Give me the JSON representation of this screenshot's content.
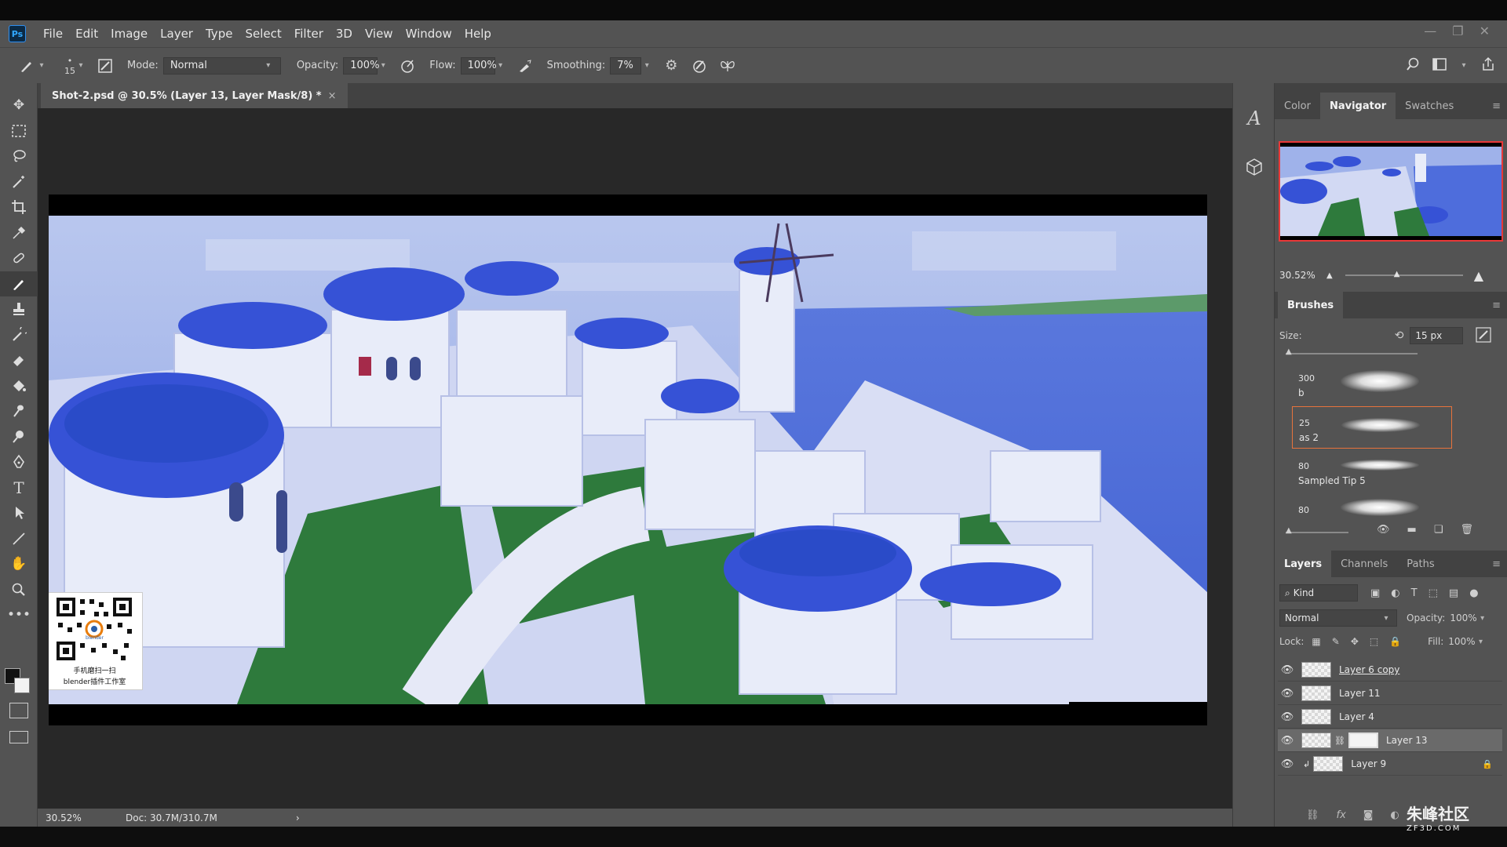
{
  "app": {
    "logo": "Ps",
    "menu": [
      "File",
      "Edit",
      "Image",
      "Layer",
      "Type",
      "Select",
      "Filter",
      "3D",
      "View",
      "Window",
      "Help"
    ],
    "window_controls": [
      "minimize-icon",
      "restore-icon",
      "close-icon"
    ]
  },
  "options": {
    "brush_size": "15",
    "mode_label": "Mode:",
    "mode_value": "Normal",
    "opacity_label": "Opacity:",
    "opacity_value": "100%",
    "flow_label": "Flow:",
    "flow_value": "100%",
    "smoothing_label": "Smoothing:",
    "smoothing_value": "7%"
  },
  "document": {
    "tab_title": "Shot-2.psd @ 30.5% (Layer 13, Layer Mask/8) *",
    "tab_close": "×",
    "watermark_line1": "手机磨扫一扫",
    "watermark_line2": "blender插件工作室",
    "watermark_badge": "blender"
  },
  "status": {
    "zoom": "30.52%",
    "doc_size": "Doc: 30.7M/310.7M",
    "arrow": "›"
  },
  "navigator": {
    "tabs": [
      "Color",
      "Navigator",
      "Swatches"
    ],
    "active_tab": "Navigator",
    "zoom": "30.52%"
  },
  "brushes": {
    "title": "Brushes",
    "size_label": "Size:",
    "size_value": "15 px",
    "items": [
      {
        "size": "300",
        "name": "b"
      },
      {
        "size": "25",
        "name": "as 2"
      },
      {
        "size": "80",
        "name": "Sampled Tip 5"
      },
      {
        "size": "80",
        "name": ""
      }
    ],
    "selected_index": 1
  },
  "layers": {
    "tabs": [
      "Layers",
      "Channels",
      "Paths"
    ],
    "active_tab": "Layers",
    "filter_label": "Kind",
    "blend_mode": "Normal",
    "opacity_label": "Opacity:",
    "opacity_value": "100%",
    "lock_label": "Lock:",
    "fill_label": "Fill:",
    "fill_value": "100%",
    "list": [
      {
        "name": "Layer 6 copy",
        "mask": false,
        "selected": false
      },
      {
        "name": "Layer 11",
        "mask": false,
        "selected": false
      },
      {
        "name": "Layer 4",
        "mask": false,
        "selected": false
      },
      {
        "name": "Layer 13",
        "mask": true,
        "selected": true
      },
      {
        "name": "Layer 9",
        "mask": false,
        "selected": false
      }
    ]
  },
  "corner_watermark": {
    "text": "朱峰社区",
    "sub": "ZF3D.COM"
  },
  "colors": {
    "accent_select": "#e8733c",
    "nav_frame": "#e83838",
    "panel": "#535353",
    "canvas_bg": "#282828"
  }
}
